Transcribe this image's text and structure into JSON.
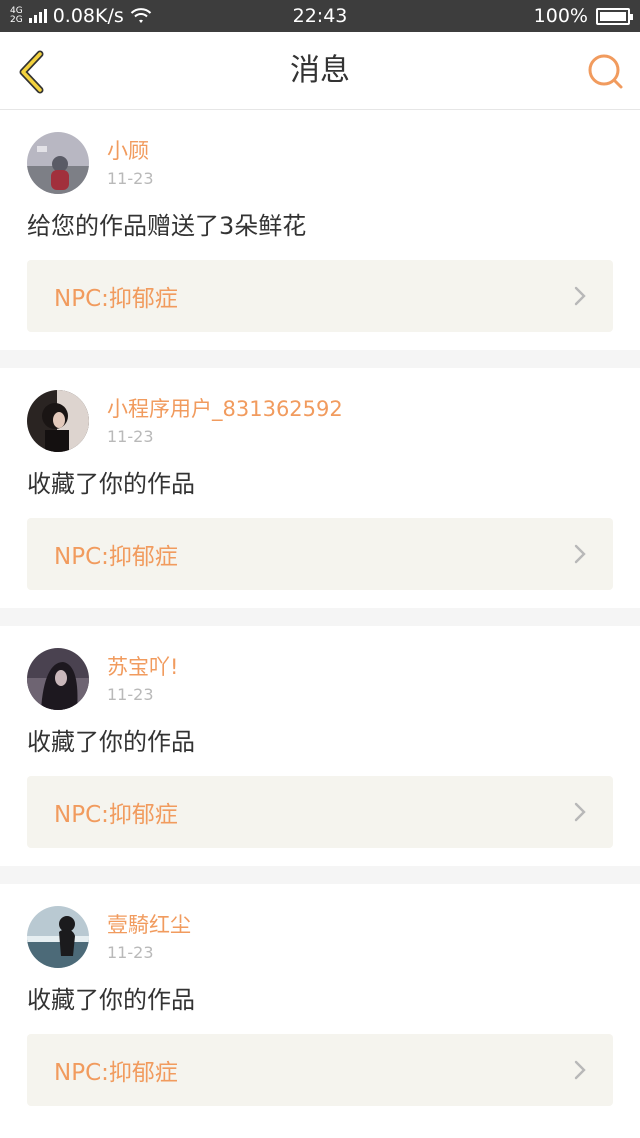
{
  "status_bar": {
    "network_types": [
      "4G",
      "2G"
    ],
    "speed": "0.08K/s",
    "time": "22:43",
    "battery": "100%",
    "battery_level": 1.0
  },
  "header": {
    "title": "消息",
    "back_icon": "chevron-left-icon",
    "search_icon": "search-icon",
    "accent": "#f19b5e"
  },
  "messages": [
    {
      "username": "小顾",
      "time": "11-23",
      "action": "给您的作品赠送了3朵鲜花",
      "work_title": "NPC:抑郁症"
    },
    {
      "username": "小程序用户_831362592",
      "time": "11-23",
      "action": "收藏了你的作品",
      "work_title": "NPC:抑郁症"
    },
    {
      "username": "苏宝吖!",
      "time": "11-23",
      "action": "收藏了你的作品",
      "work_title": "NPC:抑郁症"
    },
    {
      "username": "壹騎红尘",
      "time": "11-23",
      "action": "收藏了你的作品",
      "work_title": "NPC:抑郁症"
    }
  ]
}
